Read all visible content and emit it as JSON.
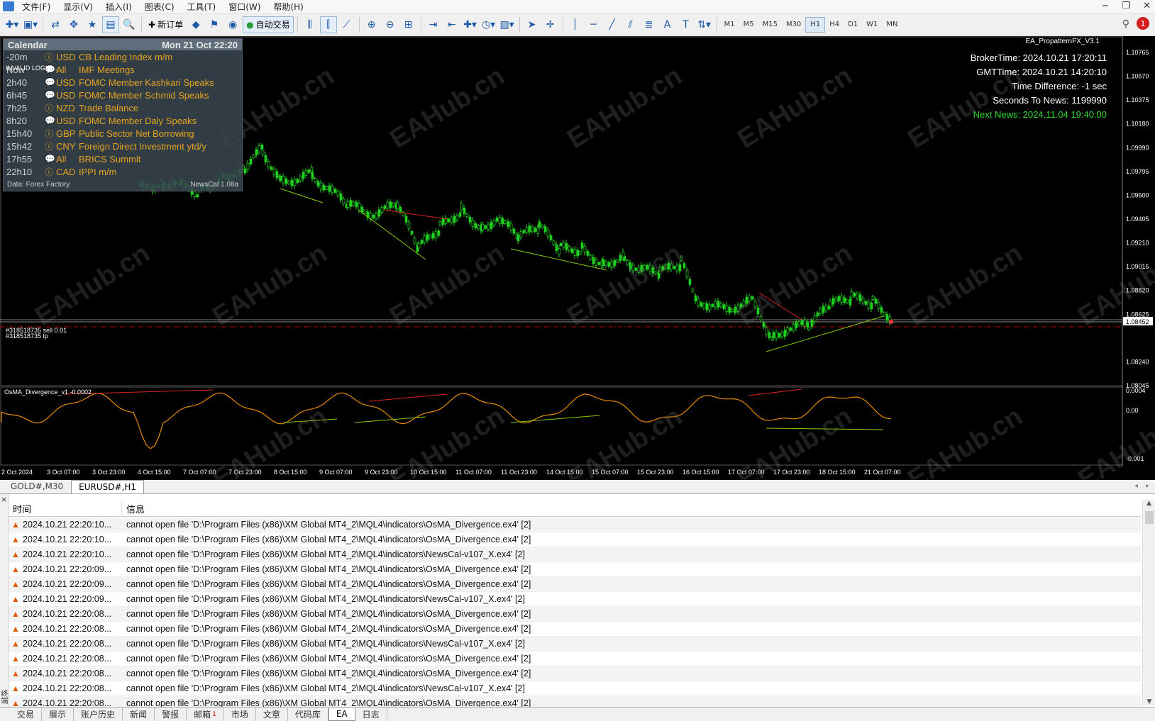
{
  "menu": [
    "文件(F)",
    "显示(V)",
    "插入(I)",
    "图表(C)",
    "工具(T)",
    "窗口(W)",
    "帮助(H)"
  ],
  "toolbar": {
    "new_order": "新订单",
    "auto_trade": "自动交易",
    "timeframes": [
      "M1",
      "M5",
      "M15",
      "M30",
      "H1",
      "H4",
      "D1",
      "W1",
      "MN"
    ],
    "active_timeframe": "H1"
  },
  "chart": {
    "ea_name": "EA_PropatternFX_V3.1",
    "info": {
      "broker": "BrokerTime: 2024.10.21 17:20:11",
      "gmt": "GMTTime: 2024.10.21 14:20:10",
      "diff": "Time Difference: -1 sec",
      "seconds": "Seconds To News: 1199990",
      "next": "Next News: 2024.11.04 19:40:00"
    },
    "invalid_login": "INVALID LOGIN...",
    "order_label_1": "#318518735 sell 0.01",
    "order_label_2": "#318518735 tp",
    "current_price": "1.08452",
    "price_ticks": [
      "1.10765",
      "1.10570",
      "1.10375",
      "1.10180",
      "1.09990",
      "1.09795",
      "1.09600",
      "1.09405",
      "1.09210",
      "1.09015",
      "1.08820",
      "1.08625",
      "1.08452",
      "1.08240",
      "1.08045"
    ],
    "indicator_label": "OsMA_Divergence_v1 -0.0002",
    "indicator_ticks": [
      "0.0004",
      "0.00",
      "-0.001"
    ],
    "time_ticks": [
      "2 Oct 2024",
      "3 Oct 07:00",
      "3 Oct 23:00",
      "4 Oct 15:00",
      "7 Oct 07:00",
      "7 Oct 23:00",
      "8 Oct 15:00",
      "9 Oct 07:00",
      "9 Oct 23:00",
      "10 Oct 15:00",
      "11 Oct 07:00",
      "11 Oct 23:00",
      "14 Oct 15:00",
      "15 Oct 07:00",
      "15 Oct 23:00",
      "16 Oct 15:00",
      "17 Oct 07:00",
      "17 Oct 23:00",
      "18 Oct 15:00",
      "21 Oct 07:00"
    ],
    "watermark": "EAHub.cn"
  },
  "calendar": {
    "title": "Calendar",
    "date": "Mon 21 Oct 22:20",
    "footer_left": "Data: Forex Factory",
    "footer_right": "NewsCal 1.08a",
    "rows": [
      {
        "time": "-20m",
        "icon": "ⓘ",
        "currency": "USD",
        "event": "CB Leading Index m/m"
      },
      {
        "time": "Now",
        "icon": "💬",
        "currency": "All",
        "event": "IMF Meetings"
      },
      {
        "time": "2h40",
        "icon": "💬",
        "currency": "USD",
        "event": "FOMC Member Kashkari Speaks"
      },
      {
        "time": "6h45",
        "icon": "💬",
        "currency": "USD",
        "event": "FOMC Member Schmid Speaks"
      },
      {
        "time": "7h25",
        "icon": "ⓘ",
        "currency": "NZD",
        "event": "Trade Balance"
      },
      {
        "time": "8h20",
        "icon": "💬",
        "currency": "USD",
        "event": "FOMC Member Daly Speaks"
      },
      {
        "time": "15h40",
        "icon": "ⓘ",
        "currency": "GBP",
        "event": "Public Sector Net Borrowing"
      },
      {
        "time": "15h42",
        "icon": "ⓘ",
        "currency": "CNY",
        "event": "Foreign Direct Investment ytd/y"
      },
      {
        "time": "17h55",
        "icon": "💬",
        "currency": "All",
        "event": "BRICS Summit"
      },
      {
        "time": "22h10",
        "icon": "ⓘ",
        "currency": "CAD",
        "event": "IPPI m/m"
      }
    ]
  },
  "chart_tabs": [
    "GOLD#,M30",
    "EURUSD#,H1"
  ],
  "journal": {
    "col_time": "时间",
    "col_msg": "信息",
    "rows": [
      {
        "time": "2024.10.21 22:20:10...",
        "msg": "cannot open file 'D:\\Program Files (x86)\\XM Global MT4_2\\MQL4\\indicators\\OsMA_Divergence.ex4' [2]"
      },
      {
        "time": "2024.10.21 22:20:10...",
        "msg": "cannot open file 'D:\\Program Files (x86)\\XM Global MT4_2\\MQL4\\indicators\\OsMA_Divergence.ex4' [2]"
      },
      {
        "time": "2024.10.21 22:20:10...",
        "msg": "cannot open file 'D:\\Program Files (x86)\\XM Global MT4_2\\MQL4\\indicators\\NewsCal-v107_X.ex4' [2]"
      },
      {
        "time": "2024.10.21 22:20:09...",
        "msg": "cannot open file 'D:\\Program Files (x86)\\XM Global MT4_2\\MQL4\\indicators\\OsMA_Divergence.ex4' [2]"
      },
      {
        "time": "2024.10.21 22:20:09...",
        "msg": "cannot open file 'D:\\Program Files (x86)\\XM Global MT4_2\\MQL4\\indicators\\OsMA_Divergence.ex4' [2]"
      },
      {
        "time": "2024.10.21 22:20:09...",
        "msg": "cannot open file 'D:\\Program Files (x86)\\XM Global MT4_2\\MQL4\\indicators\\NewsCal-v107_X.ex4' [2]"
      },
      {
        "time": "2024.10.21 22:20:08...",
        "msg": "cannot open file 'D:\\Program Files (x86)\\XM Global MT4_2\\MQL4\\indicators\\OsMA_Divergence.ex4' [2]"
      },
      {
        "time": "2024.10.21 22:20:08...",
        "msg": "cannot open file 'D:\\Program Files (x86)\\XM Global MT4_2\\MQL4\\indicators\\OsMA_Divergence.ex4' [2]"
      },
      {
        "time": "2024.10.21 22:20:08...",
        "msg": "cannot open file 'D:\\Program Files (x86)\\XM Global MT4_2\\MQL4\\indicators\\NewsCal-v107_X.ex4' [2]"
      },
      {
        "time": "2024.10.21 22:20:08...",
        "msg": "cannot open file 'D:\\Program Files (x86)\\XM Global MT4_2\\MQL4\\indicators\\OsMA_Divergence.ex4' [2]"
      },
      {
        "time": "2024.10.21 22:20:08...",
        "msg": "cannot open file 'D:\\Program Files (x86)\\XM Global MT4_2\\MQL4\\indicators\\OsMA_Divergence.ex4' [2]"
      },
      {
        "time": "2024.10.21 22:20:08...",
        "msg": "cannot open file 'D:\\Program Files (x86)\\XM Global MT4_2\\MQL4\\indicators\\NewsCal-v107_X.ex4' [2]"
      },
      {
        "time": "2024.10.21 22:20:08...",
        "msg": "cannot open file 'D:\\Program Files (x86)\\XM Global MT4_2\\MQL4\\indicators\\OsMA_Divergence.ex4' [2]"
      }
    ]
  },
  "terminal_side_label": "终端",
  "bottom_tabs": [
    {
      "label": "交易"
    },
    {
      "label": "展示"
    },
    {
      "label": "账户历史"
    },
    {
      "label": "新闻"
    },
    {
      "label": "警报"
    },
    {
      "label": "邮箱",
      "badge": "1"
    },
    {
      "label": "市场"
    },
    {
      "label": "文章"
    },
    {
      "label": "代码库"
    },
    {
      "label": "EA",
      "active": true
    },
    {
      "label": "日志"
    }
  ]
}
